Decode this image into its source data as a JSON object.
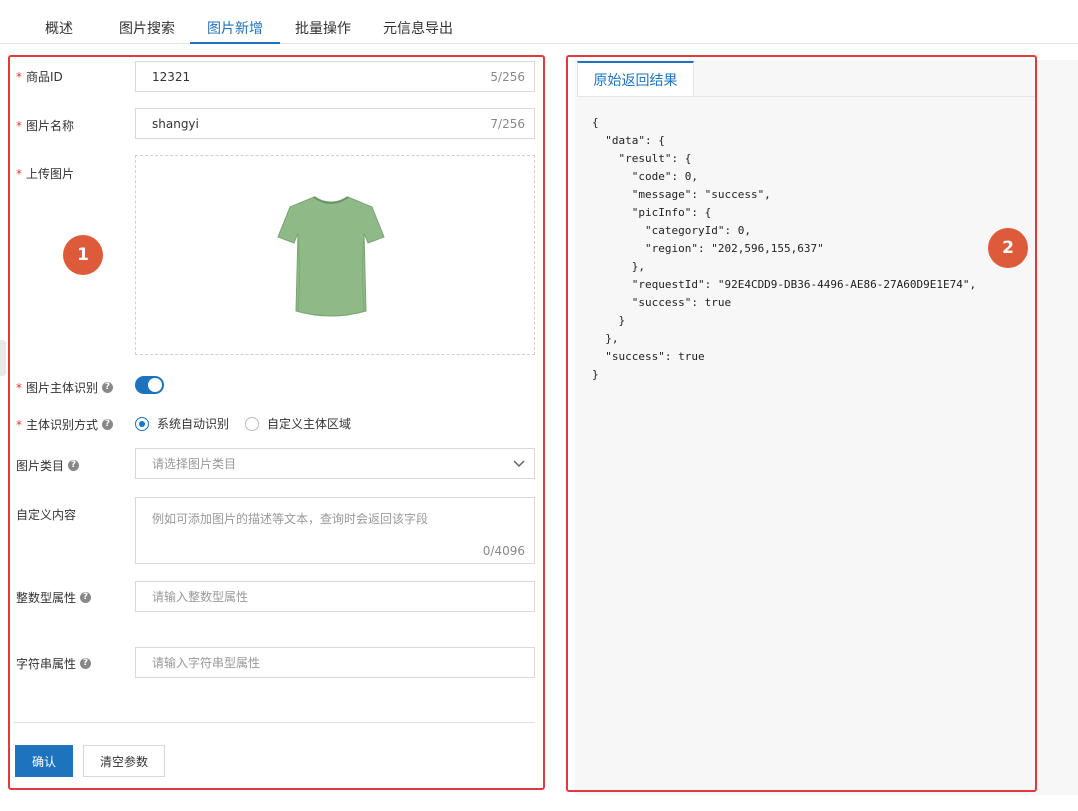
{
  "tabs": [
    {
      "label": "概述"
    },
    {
      "label": "图片搜索"
    },
    {
      "label": "图片新增"
    },
    {
      "label": "批量操作"
    },
    {
      "label": "元信息导出"
    }
  ],
  "active_tab": "图片新增",
  "form": {
    "product_id": {
      "label": "商品ID",
      "value": "12321",
      "counter": "5/256",
      "required": true
    },
    "image_name": {
      "label": "图片名称",
      "value": "shangyi",
      "counter": "7/256",
      "required": true
    },
    "upload": {
      "label": "上传图片",
      "required": true,
      "image": "green-tshirt"
    },
    "subject_detect": {
      "label": "图片主体识别",
      "enabled": true,
      "required": true
    },
    "detect_mode": {
      "label": "主体识别方式",
      "required": true,
      "options": [
        "系统自动识别",
        "自定义主体区域"
      ],
      "selected": "系统自动识别"
    },
    "category": {
      "label": "图片类目",
      "placeholder": "请选择图片类目"
    },
    "custom_content": {
      "label": "自定义内容",
      "placeholder": "例如可添加图片的描述等文本，查询时会返回该字段",
      "counter": "0/4096"
    },
    "int_attr": {
      "label": "整数型属性",
      "placeholder": "请输入整数型属性"
    },
    "str_attr": {
      "label": "字符串属性",
      "placeholder": "请输入字符串型属性"
    }
  },
  "buttons": {
    "confirm": "确认",
    "clear": "清空参数"
  },
  "result": {
    "tab_label": "原始返回结果",
    "json_text": "{\n  \"data\": {\n    \"result\": {\n      \"code\": 0,\n      \"message\": \"success\",\n      \"picInfo\": {\n        \"categoryId\": 0,\n        \"region\": \"202,596,155,637\"\n      },\n      \"requestId\": \"92E4CDD9-DB36-4496-AE86-27A60D9E1E74\",\n      \"success\": true\n    }\n  },\n  \"success\": true\n}"
  },
  "annotations": {
    "badge1": "1",
    "badge2": "2"
  },
  "colors": {
    "accent": "#1e73be",
    "annotation_border": "#e0393e",
    "badge": "#dd5a3a",
    "shirt": "#8fb987"
  }
}
